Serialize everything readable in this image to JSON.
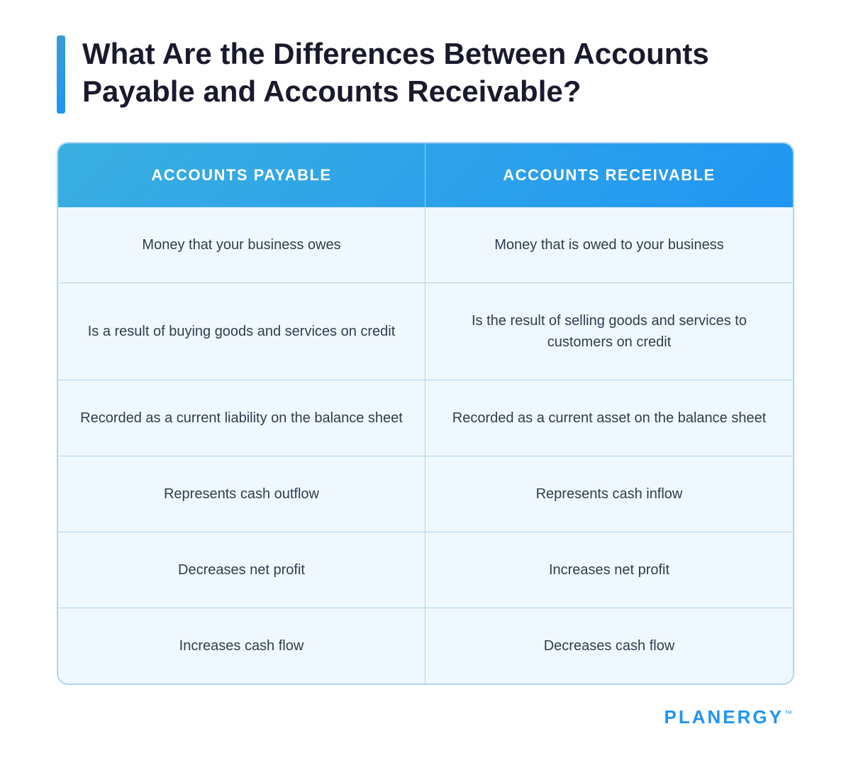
{
  "page": {
    "title": "What Are the Differences Between Accounts Payable and Accounts Receivable?",
    "background_color": "#ffffff"
  },
  "table": {
    "header": {
      "col1": "ACCOUNTS PAYABLE",
      "col2": "ACCOUNTS RECEIVABLE"
    },
    "rows": [
      {
        "col1": "Money that your business owes",
        "col2": "Money that is owed to your business"
      },
      {
        "col1": "Is a result of buying goods and services on credit",
        "col2": "Is the result of selling goods and services to customers on credit"
      },
      {
        "col1": "Recorded as a current liability on the balance sheet",
        "col2": "Recorded as a current asset on the balance sheet"
      },
      {
        "col1": "Represents cash outflow",
        "col2": "Represents cash inflow"
      },
      {
        "col1": "Decreases net profit",
        "col2": "Increases net profit"
      },
      {
        "col1": "Increases cash flow",
        "col2": "Decreases cash flow"
      }
    ]
  },
  "logo": {
    "text": "PLANERGY",
    "tm": "™"
  }
}
